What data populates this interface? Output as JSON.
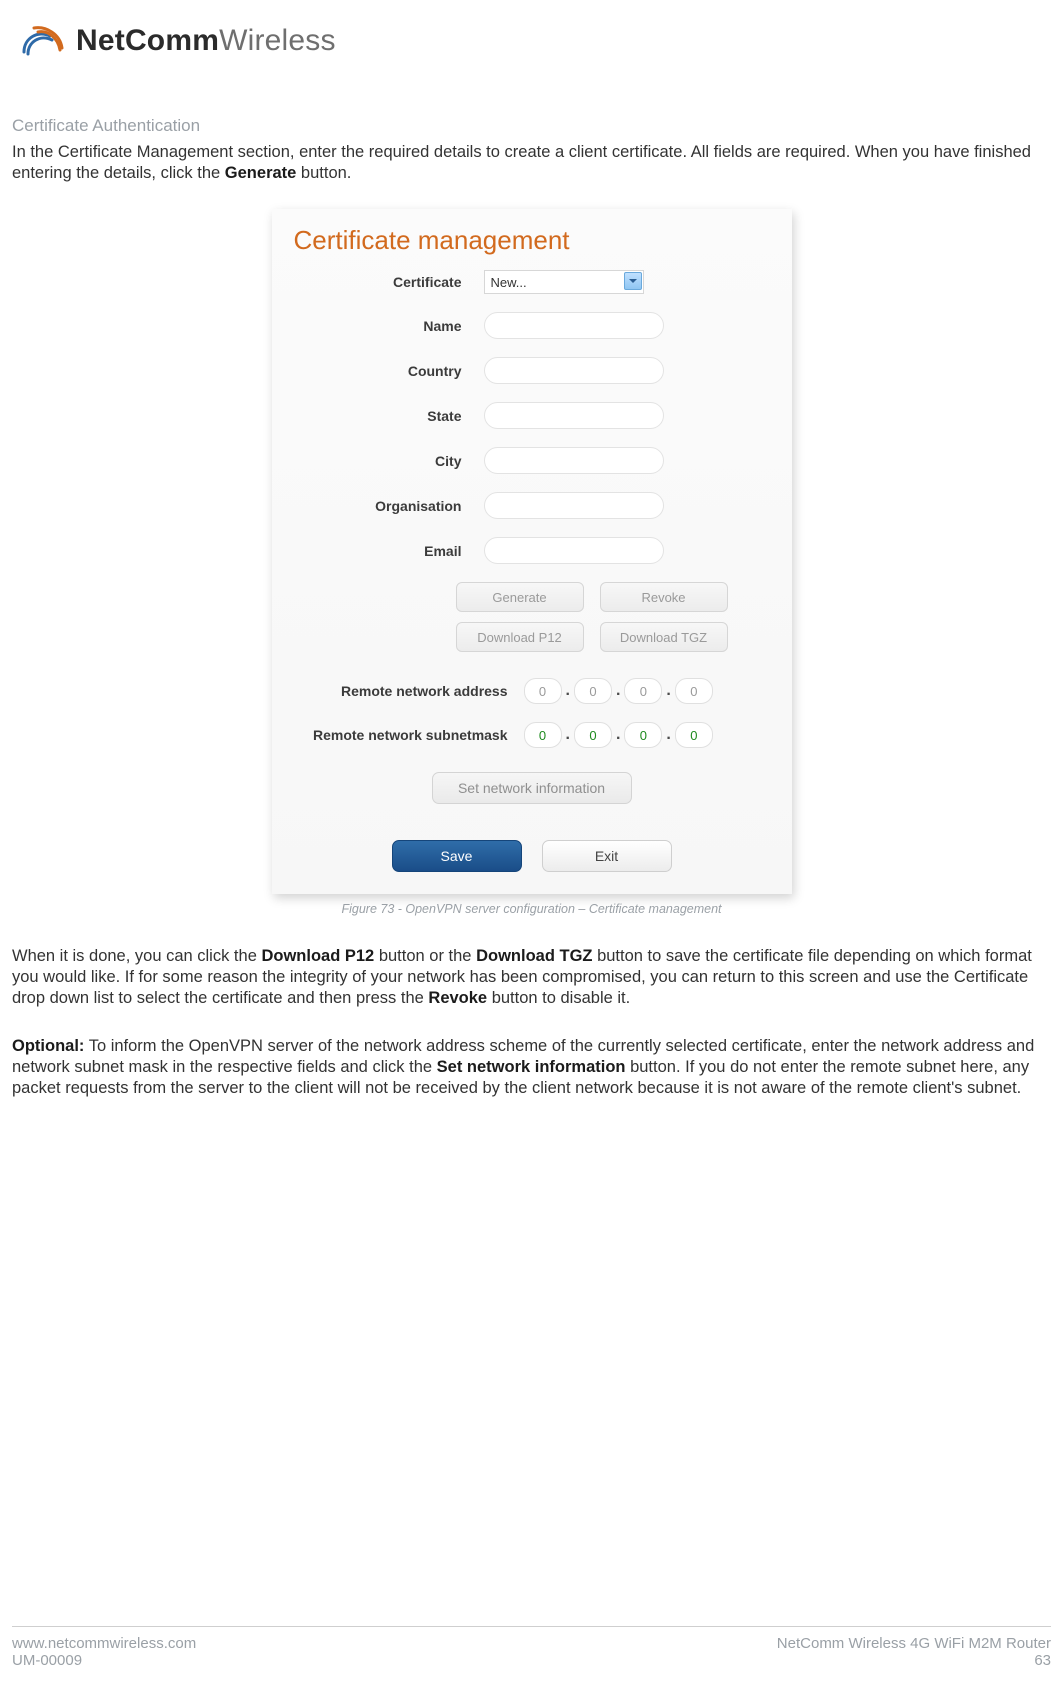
{
  "logo": {
    "brand_bold": "NetComm",
    "brand_light": "Wireless"
  },
  "section_title": "Certificate Authentication",
  "intro": {
    "t1": "In the Certificate Management section, enter the required details to create a client certificate. All fields are required. When you have finished entering the details, click the ",
    "b1": "Generate",
    "t2": " button."
  },
  "panel": {
    "title": "Certificate management",
    "labels": {
      "certificate": "Certificate",
      "name": "Name",
      "country": "Country",
      "state": "State",
      "city": "City",
      "organisation": "Organisation",
      "email": "Email",
      "remote_addr": "Remote network address",
      "remote_mask": "Remote network subnetmask"
    },
    "certificate_value": "New...",
    "buttons": {
      "generate": "Generate",
      "revoke": "Revoke",
      "download_p12": "Download P12",
      "download_tgz": "Download TGZ",
      "set_network": "Set network information",
      "save": "Save",
      "exit": "Exit"
    },
    "ip_addr": [
      "0",
      "0",
      "0",
      "0"
    ],
    "ip_mask": [
      "0",
      "0",
      "0",
      "0"
    ]
  },
  "figure_caption": "Figure 73 - OpenVPN server configuration – Certificate management",
  "para1": {
    "t1": "When it is done, you can click the ",
    "b1": "Download P12",
    "t2": " button or the ",
    "b2": "Download TGZ",
    "t3": " button to save the certificate file depending on which format you would like. If for some reason the integrity of your network has been compromised, you can return to this screen and use the Certificate drop down list to select the certificate and then press the ",
    "b3": "Revoke",
    "t4": " button to disable it."
  },
  "para2": {
    "b0": "Optional:",
    "t1": " To inform the OpenVPN server of the network address scheme of the currently selected certificate, enter the network address and network subnet mask in the respective fields and click the ",
    "b1": "Set network information",
    "t2": " button. If you do not enter the remote subnet here, any packet requests from the server to the client will not be received by the client network because it is not aware of the remote client's subnet."
  },
  "footer": {
    "url": "www.netcommwireless.com",
    "doc_id": "UM-00009",
    "product": "NetComm Wireless 4G WiFi M2M Router",
    "page": "63"
  }
}
